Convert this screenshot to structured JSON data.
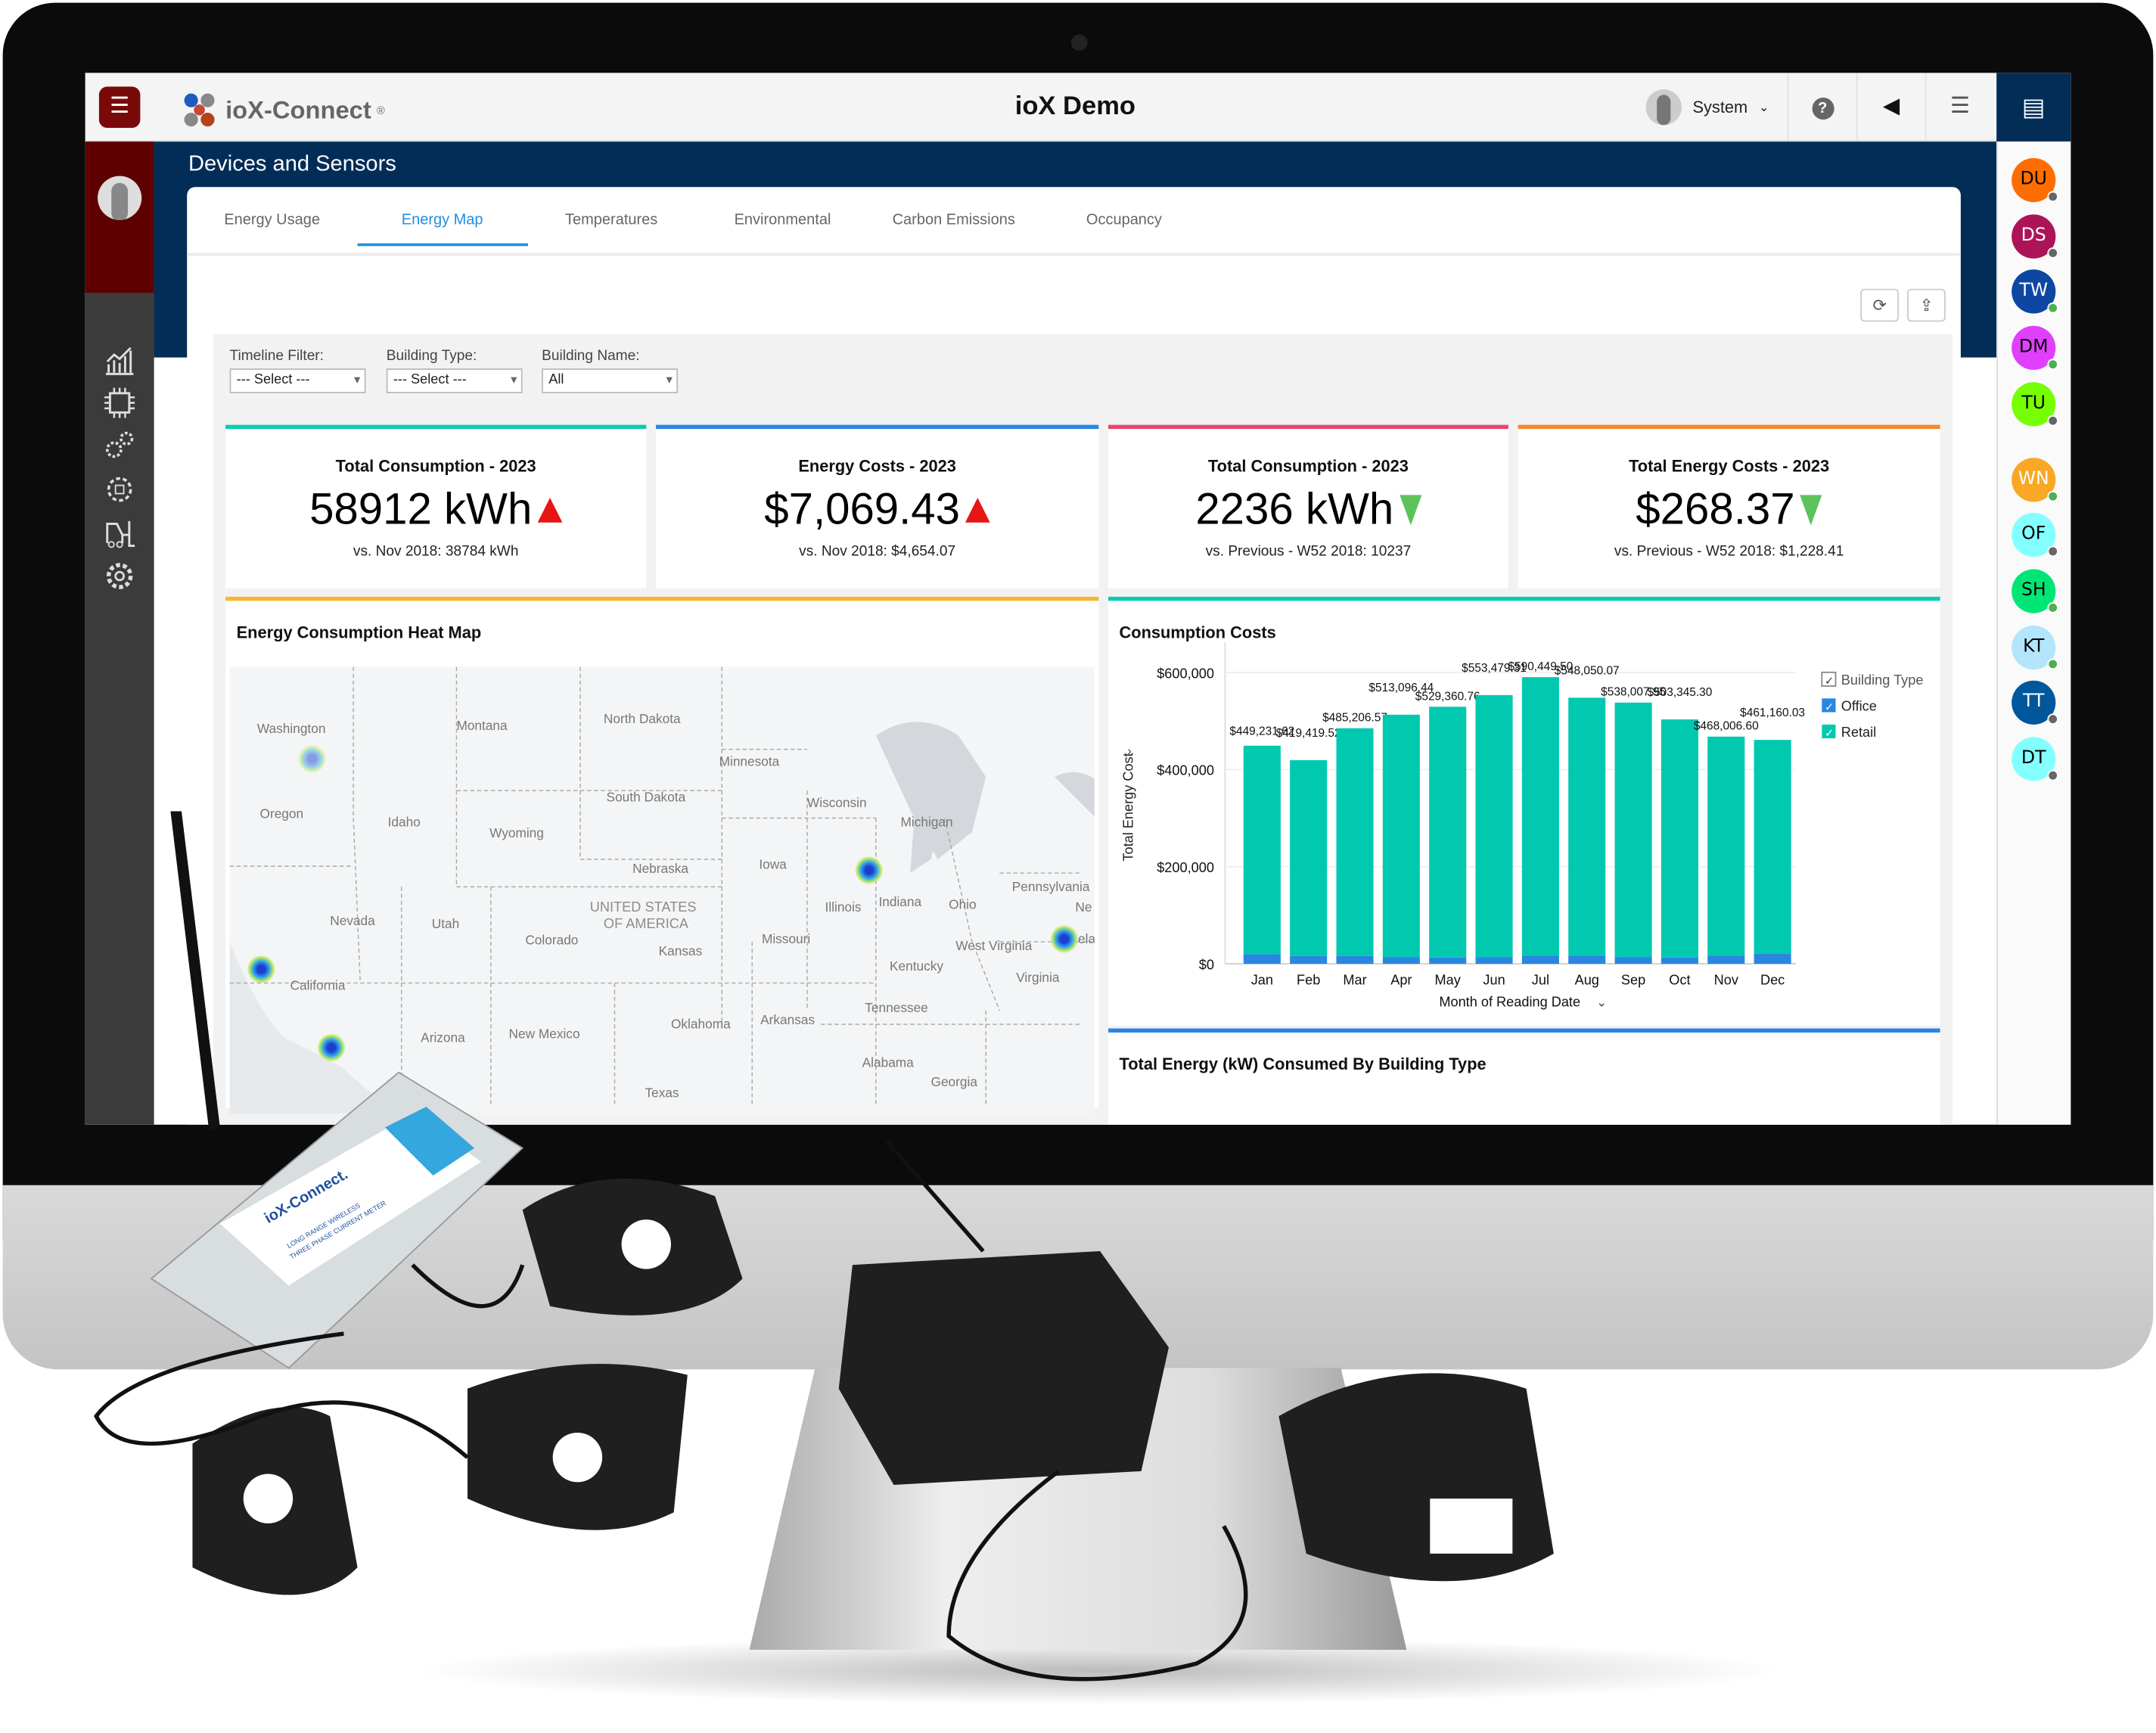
{
  "header": {
    "menu_icon": "hamburger-icon",
    "logo_text": "ioX-Connect",
    "logo_mark": "®",
    "title": "ioX Demo",
    "user_name": "System",
    "icons": [
      "help-icon",
      "megaphone-icon",
      "list-icon"
    ],
    "chat_icon": "chat-icon"
  },
  "page": {
    "title": "Devices and Sensors"
  },
  "tabs": [
    {
      "label": "Energy Usage"
    },
    {
      "label": "Energy Map",
      "active": true
    },
    {
      "label": "Temperatures"
    },
    {
      "label": "Environmental"
    },
    {
      "label": "Carbon Emissions"
    },
    {
      "label": "Occupancy"
    }
  ],
  "toolbar": {
    "refresh_icon": "refresh-icon",
    "export_icon": "export-icon"
  },
  "filters": [
    {
      "label": "Timeline Filter:",
      "value": "--- Select ---"
    },
    {
      "label": "Building Type:",
      "value": "--- Select ---"
    },
    {
      "label": "Building Name:",
      "value": "All"
    }
  ],
  "kpis": [
    {
      "title": "Total Consumption - 2023",
      "value": "58912 kWh",
      "trend": "up",
      "compare": "vs. Nov 2018: 38784 kWh",
      "color": "#0acbb0"
    },
    {
      "title": "Energy Costs - 2023",
      "value": "$7,069.43",
      "trend": "up",
      "compare": "vs. Nov 2018: $4,654.07",
      "color": "#2a86e0"
    },
    {
      "title": "Total Consumption - 2023",
      "value": "2236 kWh",
      "trend": "down",
      "compare": "vs. Previous - W52 2018: 10237",
      "color": "#e8466b"
    },
    {
      "title": "Total Energy Costs - 2023",
      "value": "$268.37",
      "trend": "down",
      "compare": "vs. Previous - W52 2018: $1,228.41",
      "color": "#f5892a"
    }
  ],
  "map": {
    "title": "Energy Consumption Heat Map",
    "country_label": [
      "UNITED STATES",
      "OF AMERICA"
    ],
    "states": [
      "Washington",
      "Montana",
      "North Dakota",
      "Minnesota",
      "Oregon",
      "Idaho",
      "South Dakota",
      "Wisconsin",
      "Michigan",
      "Wyoming",
      "Nebraska",
      "Iowa",
      "Pennsylvania",
      "Nevada",
      "Utah",
      "Colorado",
      "Kansas",
      "Illinois",
      "Indiana",
      "Ohio",
      "Missouri",
      "West Virginia",
      "California",
      "Kentucky",
      "Virginia",
      "Tennessee",
      "Arizona",
      "New Mexico",
      "Oklahoma",
      "Arkansas",
      "Alabama",
      "Georgia",
      "Texas",
      "Ne",
      "ela"
    ]
  },
  "chart_data": {
    "type": "bar",
    "stacked": true,
    "title": "Consumption Costs",
    "xlabel": "Month of Reading Date",
    "ylabel": "Total Energy Cost",
    "categories": [
      "Jan",
      "Feb",
      "Mar",
      "Apr",
      "May",
      "Jun",
      "Jul",
      "Aug",
      "Sep",
      "Oct",
      "Nov",
      "Dec"
    ],
    "totals": [
      449231.62,
      419419.52,
      485206.57,
      513096.44,
      529360.76,
      553479.31,
      590449.5,
      548050.07,
      538007.95,
      503345.3,
      468006.6,
      461160.03
    ],
    "total_labels": [
      "$449,231.62",
      "$419,419.52",
      "$485,206.57",
      "$513,096.44",
      "$529,360.76",
      "$553,479.31",
      "$590,449.50",
      "$548,050.07",
      "$538,007.95",
      "$503,345.30",
      "$468,006.60",
      "$461,160.03"
    ],
    "series": [
      {
        "name": "Office",
        "color": "#2a86e0",
        "values": [
          20000,
          16000,
          16000,
          14000,
          13000,
          14000,
          17000,
          17000,
          14000,
          13000,
          17000,
          21000
        ]
      },
      {
        "name": "Retail",
        "color": "#00c9b0",
        "values": [
          429231.62,
          403419.52,
          469206.57,
          499096.44,
          516360.76,
          539479.31,
          573449.5,
          531050.07,
          524007.95,
          490345.3,
          451006.6,
          440160.03
        ]
      }
    ],
    "yticks": [
      "$0",
      "$200,000",
      "$400,000",
      "$600,000"
    ],
    "ylim": [
      0,
      640000
    ],
    "grid": true,
    "legend": {
      "title": "Building Type",
      "position": "right"
    }
  },
  "next_panel": {
    "title": "Total Energy (kW) Consumed By Building Type"
  },
  "users": [
    {
      "initials": "DU",
      "color": "#ff6d00",
      "text": "#000",
      "status": "offline"
    },
    {
      "initials": "DS",
      "color": "#ad1457",
      "text": "#fff",
      "status": "offline"
    },
    {
      "initials": "TW",
      "color": "#0d47a1",
      "text": "#fff",
      "status": "online"
    },
    {
      "initials": "DM",
      "color": "#e040fb",
      "text": "#000",
      "status": "online"
    },
    {
      "initials": "TU",
      "color": "#76ff03",
      "text": "#000",
      "status": "offline"
    },
    {
      "initials": "WN",
      "color": "#f9a825",
      "text": "#fff",
      "status": "online"
    },
    {
      "initials": "OF",
      "color": "#84ffff",
      "text": "#000",
      "status": "offline"
    },
    {
      "initials": "SH",
      "color": "#00e676",
      "text": "#000",
      "status": "online"
    },
    {
      "initials": "KT",
      "color": "#b3e5fc",
      "text": "#000",
      "status": "online"
    },
    {
      "initials": "TT",
      "color": "#01579b",
      "text": "#fff",
      "status": "offline"
    },
    {
      "initials": "DT",
      "color": "#84ffff",
      "text": "#000",
      "status": "offline"
    }
  ],
  "device_label": {
    "brand": "ioX-Connect.",
    "line1": "LONG RANGE WIRELESS",
    "line2": "THREE PHASE CURRENT METER"
  },
  "colors": {
    "brand_navy": "#022d57",
    "brand_red": "#5f0000",
    "accent": "#1f8fe0"
  }
}
